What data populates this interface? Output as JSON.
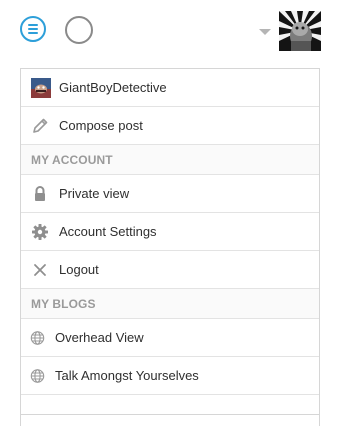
{
  "topbar": {
    "menu_icon": "hamburger-menu-icon",
    "secondary_icon": "circle-icon",
    "dropdown_icon": "caret-down-icon"
  },
  "menu": {
    "profile": {
      "label": "GiantBoyDetective",
      "icon": "blog-avatar-icon"
    },
    "compose": {
      "label": "Compose post",
      "icon": "pencil-icon"
    },
    "my_account_heading": "MY ACCOUNT",
    "account_items": [
      {
        "label": "Private view",
        "icon": "lock-icon"
      },
      {
        "label": "Account Settings",
        "icon": "gear-icon"
      },
      {
        "label": "Logout",
        "icon": "close-icon"
      }
    ],
    "my_blogs_heading": "MY BLOGS",
    "blogs": [
      {
        "label": "Overhead View",
        "icon": "globe-icon"
      },
      {
        "label": "Talk Amongst Yourselves",
        "icon": "globe-icon"
      }
    ]
  },
  "colors": {
    "accent": "#2d9fd9",
    "icon_gray": "#8a8a8a",
    "text": "#2f2f2f",
    "heading": "#9a9a9a",
    "border": "#e3e3e3"
  }
}
